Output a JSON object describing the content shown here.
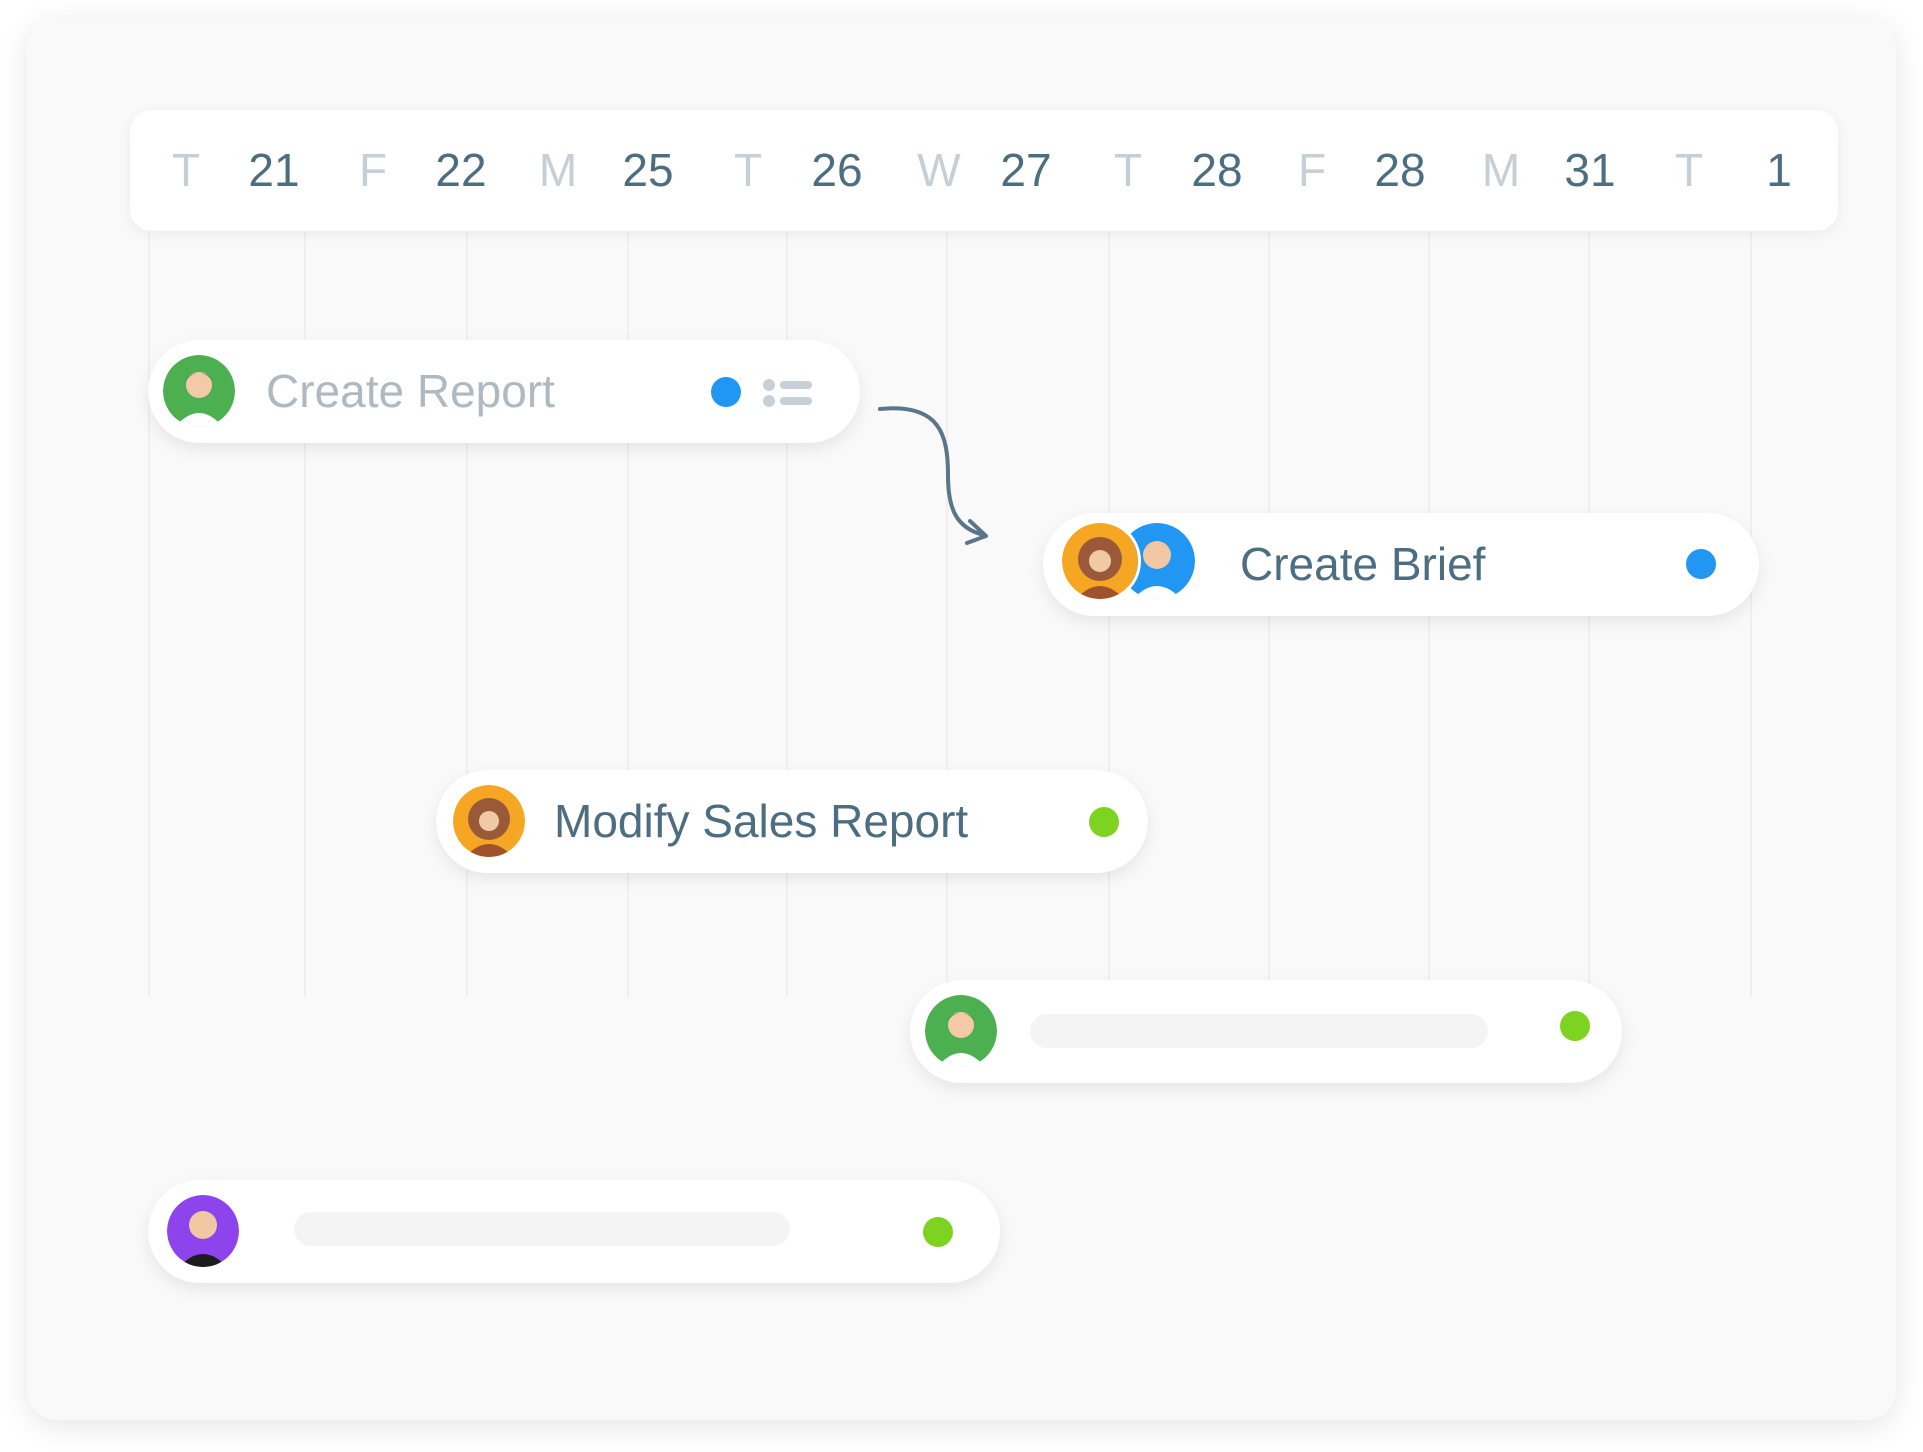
{
  "calendar": {
    "days": [
      {
        "letter": "T",
        "date": "21"
      },
      {
        "letter": "F",
        "date": "22"
      },
      {
        "letter": "M",
        "date": "25"
      },
      {
        "letter": "T",
        "date": "26"
      },
      {
        "letter": "W",
        "date": "27"
      },
      {
        "letter": "T",
        "date": "28"
      },
      {
        "letter": "F",
        "date": "28"
      },
      {
        "letter": "M",
        "date": "31"
      },
      {
        "letter": "T",
        "date": "1"
      }
    ]
  },
  "tasks": [
    {
      "title": "Create Report",
      "status_color": "#2196f3",
      "icons": [
        "list-icon"
      ],
      "avatars": [
        "green"
      ]
    },
    {
      "title": "Create Brief",
      "status_color": "#2196f3",
      "avatars": [
        "orange",
        "blue"
      ]
    },
    {
      "title": "Modify Sales Report",
      "status_color": "#7ed321",
      "avatars": [
        "orange"
      ]
    },
    {
      "title": "",
      "status_color": "#7ed321",
      "avatars": [
        "green"
      ]
    },
    {
      "title": "",
      "status_color": "#7ed321",
      "avatars": [
        "purple"
      ]
    }
  ],
  "colors": {
    "accent_blue": "#2196f3",
    "accent_green": "#7ed321",
    "text_primary": "#4d6d80",
    "text_muted": "#aeb9c1"
  }
}
